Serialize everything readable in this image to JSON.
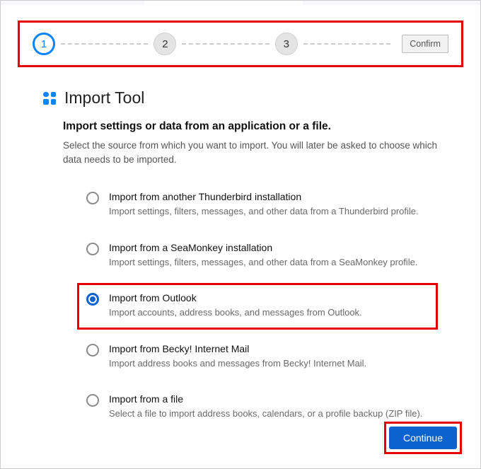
{
  "stepper": {
    "steps": [
      "1",
      "2",
      "3"
    ],
    "confirm_label": "Confirm"
  },
  "tool": {
    "title": "Import Tool",
    "subtitle": "Import settings or data from an application or a file.",
    "description": "Select the source from which you want to import. You will later be asked to choose which data needs to be imported."
  },
  "options": [
    {
      "title": "Import from another Thunderbird installation",
      "desc": "Import settings, filters, messages, and other data from a Thunderbird profile.",
      "selected": false
    },
    {
      "title": "Import from a SeaMonkey installation",
      "desc": "Import settings, filters, messages, and other data from a SeaMonkey profile.",
      "selected": false
    },
    {
      "title": "Import from Outlook",
      "desc": "Import accounts, address books, and messages from Outlook.",
      "selected": true
    },
    {
      "title": "Import from Becky! Internet Mail",
      "desc": "Import address books and messages from Becky! Internet Mail.",
      "selected": false
    },
    {
      "title": "Import from a file",
      "desc": "Select a file to import address books, calendars, or a profile backup (ZIP file).",
      "selected": false
    }
  ],
  "buttons": {
    "continue": "Continue"
  }
}
